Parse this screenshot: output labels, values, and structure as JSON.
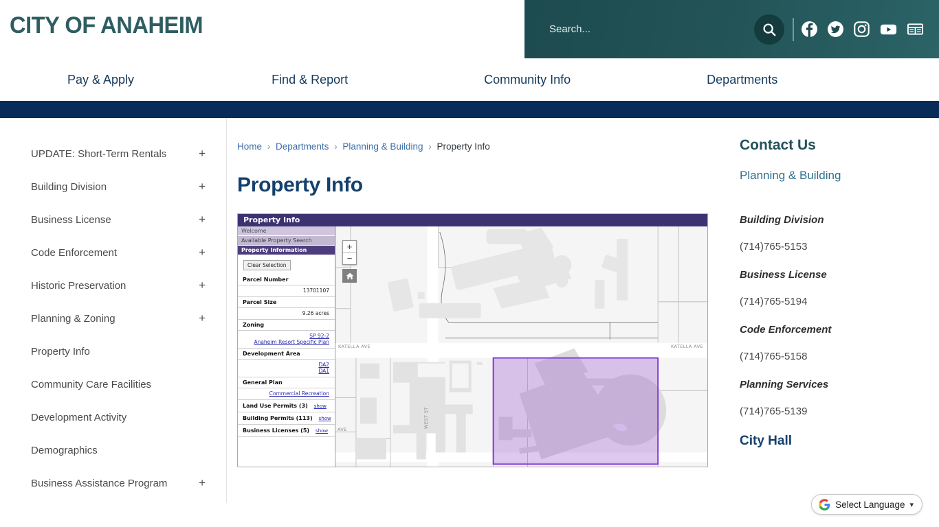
{
  "header": {
    "logo": "CITY OF ANAHEIM",
    "search_placeholder": "Search...",
    "search_value": "",
    "search_icon": "search-icon",
    "social": [
      {
        "name": "facebook-icon",
        "label": "Facebook"
      },
      {
        "name": "twitter-icon",
        "label": "Twitter"
      },
      {
        "name": "instagram-icon",
        "label": "Instagram"
      },
      {
        "name": "youtube-icon",
        "label": "YouTube"
      },
      {
        "name": "newsletter-icon",
        "label": "Newsletter"
      }
    ]
  },
  "nav": {
    "items": [
      {
        "label": "Pay & Apply"
      },
      {
        "label": "Find & Report"
      },
      {
        "label": "Community Info"
      },
      {
        "label": "Departments"
      }
    ]
  },
  "sidebar": {
    "items": [
      {
        "label": "UPDATE: Short-Term Rentals",
        "expandable": "+"
      },
      {
        "label": "Building Division",
        "expandable": "+"
      },
      {
        "label": "Business License",
        "expandable": "+"
      },
      {
        "label": "Code Enforcement",
        "expandable": "+"
      },
      {
        "label": "Historic Preservation",
        "expandable": "+"
      },
      {
        "label": "Planning & Zoning",
        "expandable": "+"
      },
      {
        "label": "Property Info",
        "expandable": ""
      },
      {
        "label": "Community Care Facilities",
        "expandable": ""
      },
      {
        "label": "Development Activity",
        "expandable": ""
      },
      {
        "label": "Demographics",
        "expandable": ""
      },
      {
        "label": "Business Assistance Program",
        "expandable": "+"
      }
    ]
  },
  "breadcrumb": {
    "home": "Home",
    "departments": "Departments",
    "planning": "Planning & Building",
    "current": "Property Info",
    "separator": "›"
  },
  "main": {
    "page_title": "Property Info"
  },
  "gis": {
    "title": "Property Info",
    "tabs": [
      {
        "label": "Welcome",
        "state": "inactive"
      },
      {
        "label": "Available Property Search",
        "state": "inactive"
      },
      {
        "label": "Property Information",
        "state": "active"
      }
    ],
    "clear_button": "Clear Selection",
    "fields": [
      {
        "label": "Parcel Number",
        "value": "13701107"
      },
      {
        "label": "Parcel Size",
        "value": "9.26 acres"
      }
    ],
    "zoning": {
      "label": "Zoning",
      "value_line1": "SP 92-2",
      "value_line2": "Anaheim Resort Specific Plan"
    },
    "development_area": {
      "label": "Development Area",
      "value_line1": "DA2",
      "value_line2": "DA1"
    },
    "general_plan": {
      "label": "General Plan",
      "value": "Commercial Recreation"
    },
    "counts": [
      {
        "label": "Land Use Permits (3)",
        "action": "show"
      },
      {
        "label": "Building Permits (113)",
        "action": "show"
      },
      {
        "label": "Business Licenses (5)",
        "action": "show"
      }
    ],
    "map": {
      "zoom_in": "+",
      "zoom_out": "−",
      "home_icon": "home-icon",
      "street_labels": [
        {
          "text": "KATELLA AVE"
        },
        {
          "text": "KATELLA AVE"
        },
        {
          "text": "WEST ST"
        },
        {
          "text": "AVE"
        }
      ],
      "selected_parcel_color": "#7a2fd4"
    }
  },
  "contact": {
    "title": "Contact Us",
    "department_link": "Planning & Building",
    "entries": [
      {
        "name": "Building Division",
        "phone": "(714)765-5153"
      },
      {
        "name": "Business License",
        "phone": "(714)765-5194"
      },
      {
        "name": "Code Enforcement",
        "phone": "(714)765-5158"
      },
      {
        "name": "Planning Services",
        "phone": "(714)765-5139"
      }
    ],
    "city_hall": "City Hall"
  },
  "language_widget": {
    "label": "Select Language",
    "icon": "google-g-icon",
    "chevron": "⌄"
  }
}
